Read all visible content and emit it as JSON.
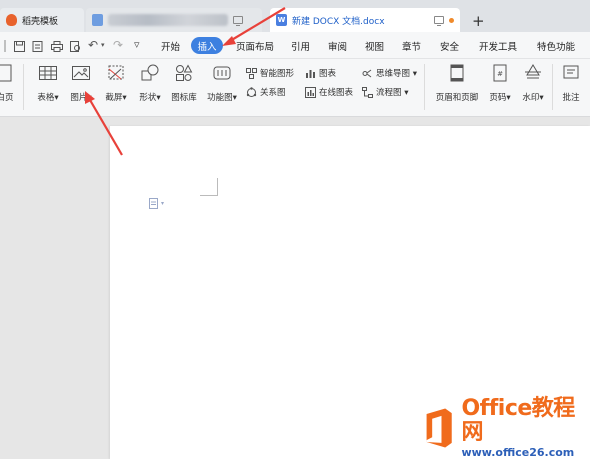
{
  "tabs": {
    "daoke_title": "稻壳模板",
    "document_title": "新建 DOCX 文档.docx",
    "new_tab_symbol": "+"
  },
  "quick_access": {
    "undo_symbol": "↶",
    "redo_symbol": "↷",
    "more_symbol": "▿"
  },
  "menu": {
    "items": [
      "开始",
      "插入",
      "页面布局",
      "引用",
      "审阅",
      "视图",
      "章节",
      "安全",
      "开发工具",
      "特色功能"
    ],
    "active": "插入"
  },
  "ribbon": {
    "page_cut": "白页",
    "table": "表格",
    "picture": "图片",
    "screenshot": "截屏",
    "shape": "形状",
    "icon_library": "图标库",
    "function_chart": "功能图",
    "smart_graphic": "智能图形",
    "chart": "图表",
    "mind_map": "思维导图",
    "relation_chart": "关系图",
    "online_chart": "在线图表",
    "flowchart": "流程图",
    "header_footer": "页眉和页脚",
    "page_number": "页码",
    "watermark": "水印",
    "comment": "批注",
    "dropdown_symbol": "▾"
  },
  "watermark_logo": {
    "brand": "Office教程网",
    "url": "www.office26.com"
  },
  "colors": {
    "accent_blue": "#3d80e0",
    "arrow_red": "#e8413a",
    "brand_orange": "#f06b1c"
  }
}
